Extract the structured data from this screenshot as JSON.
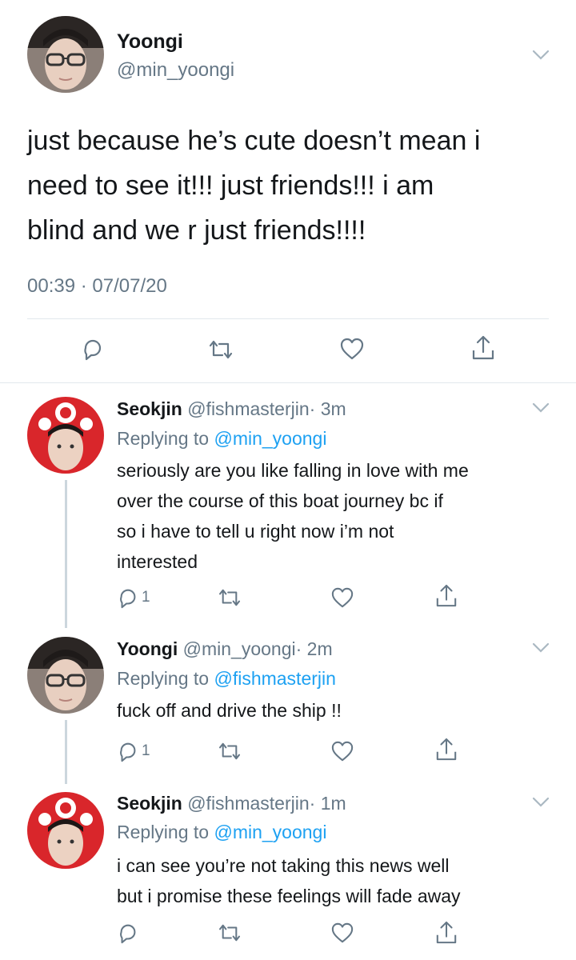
{
  "main_tweet": {
    "name": "Yoongi",
    "handle": "@min_yoongi",
    "lines": [
      "just because he’s cute doesn’t mean i",
      "need to see it!!! just friends!!! i am",
      "blind and we r just friends!!!!"
    ],
    "timestamp": "00:39 · 07/07/20",
    "actions": {
      "reply_icon": "reply-icon",
      "retweet_icon": "retweet-icon",
      "like_icon": "heart-icon",
      "share_icon": "share-icon"
    }
  },
  "replies": [
    {
      "name": "Seokjin",
      "handle": "@fishmasterjin",
      "time": "· 3m",
      "replying_prefix": "Replying to",
      "replying_to": "@min_yoongi",
      "lines": [
        "seriously are you like falling in love with me",
        "over the course of this boat journey bc if",
        "so i have to tell u right now i’m not",
        "interested"
      ],
      "reply_count": "1"
    },
    {
      "name": "Yoongi",
      "handle": "@min_yoongi",
      "time": "· 2m",
      "replying_prefix": "Replying to",
      "replying_to": "@fishmasterjin",
      "lines": [
        "fuck off and drive the ship !!"
      ],
      "reply_count": "1"
    },
    {
      "name": "Seokjin",
      "handle": "@fishmasterjin",
      "time": "· 1m",
      "replying_prefix": "Replying to",
      "replying_to": "@min_yoongi",
      "lines": [
        "i can see you’re not taking this news well",
        "but i promise these feelings will fade away"
      ],
      "reply_count": ""
    }
  ],
  "colors": {
    "text": "#14171a",
    "secondary": "#657786",
    "accent": "#1da1f2",
    "divider": "#e1e8ed"
  }
}
